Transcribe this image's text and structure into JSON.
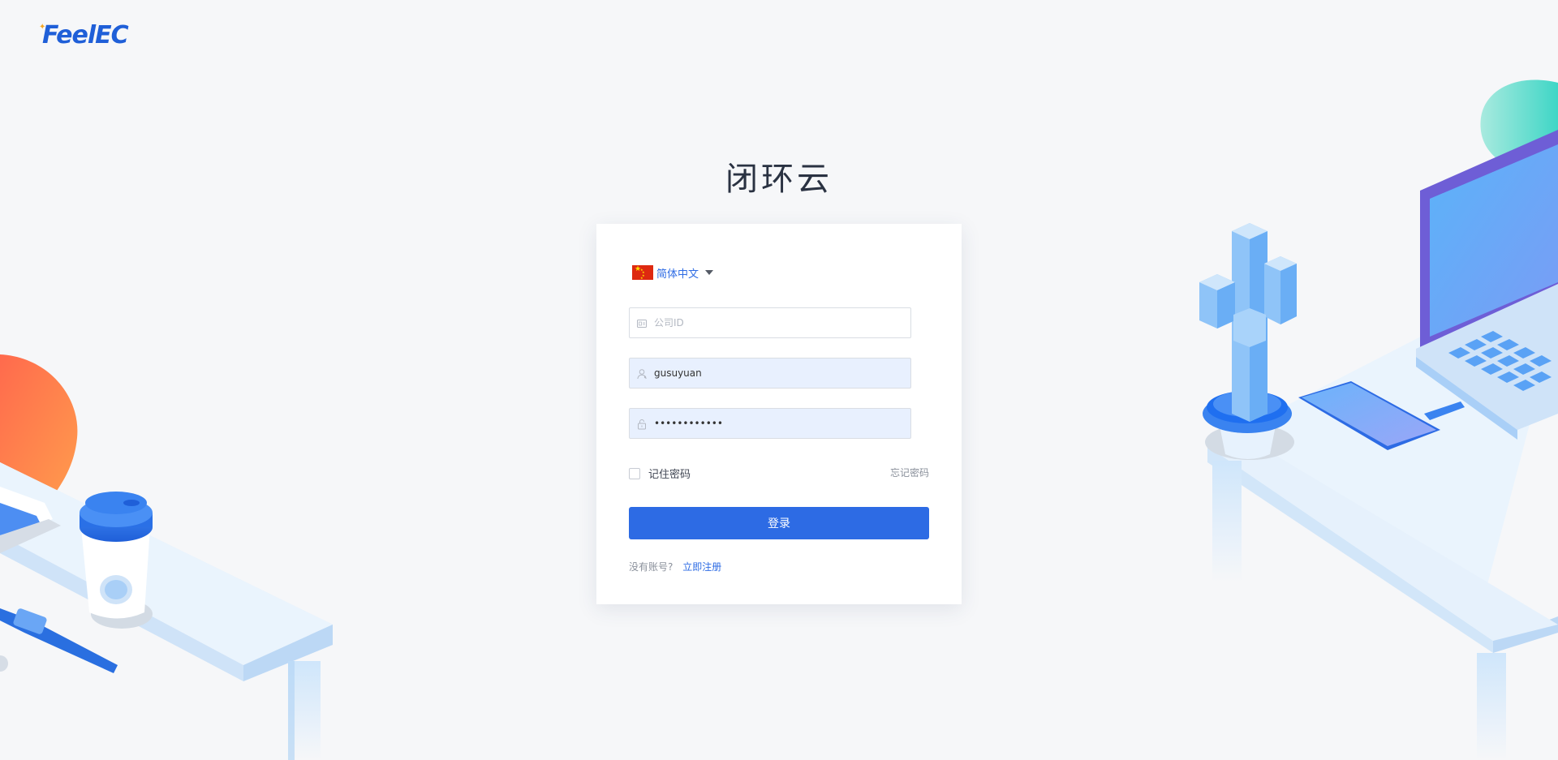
{
  "brand": {
    "logo_text": "FeelEC"
  },
  "app_title": "闭环云",
  "language": {
    "selected": "简体中文",
    "flag": "china-flag-icon"
  },
  "form": {
    "company_id": {
      "placeholder": "公司ID",
      "value": "",
      "icon": "id-card-icon"
    },
    "username": {
      "placeholder": "",
      "value": "gusuyuan",
      "icon": "user-icon"
    },
    "password": {
      "placeholder": "",
      "value": "••••••••••••",
      "icon": "lock-icon"
    },
    "remember_label": "记住密码",
    "remember_checked": false,
    "forgot_label": "忘记密码",
    "submit_label": "登录",
    "register_question": "没有账号?",
    "register_link": "立即注册"
  },
  "colors": {
    "accent": "#2d6be4",
    "background": "#f6f7f9",
    "autofill": "#e8f0fe"
  }
}
